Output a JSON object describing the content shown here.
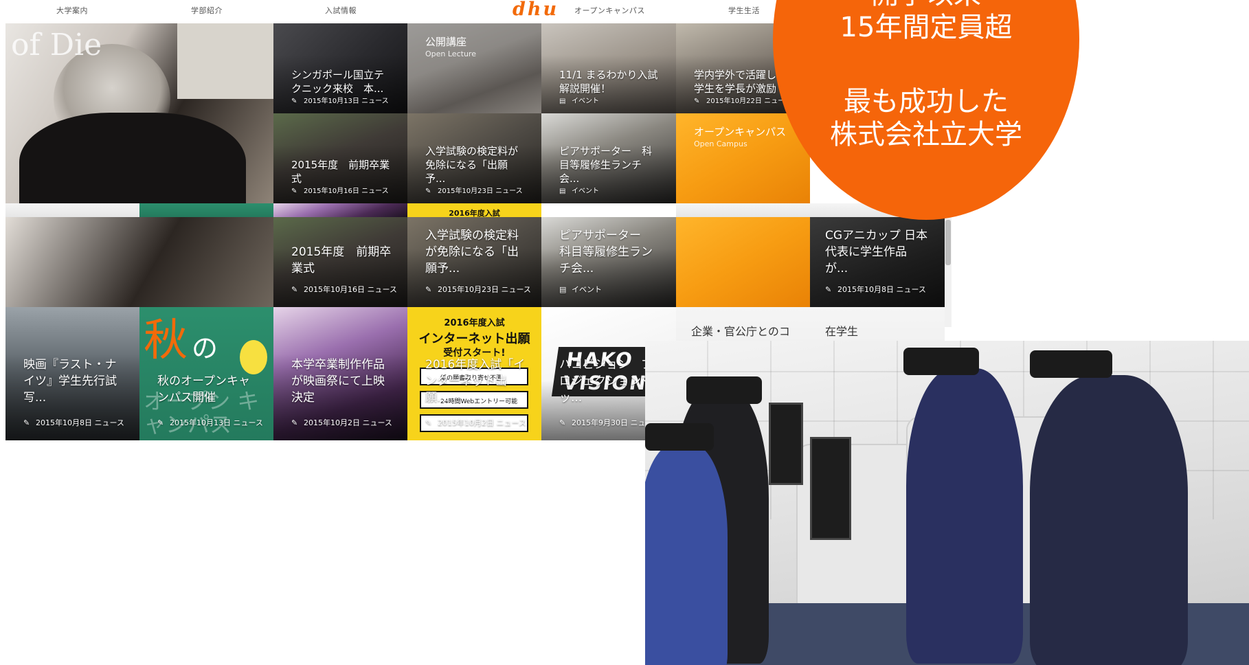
{
  "nav": {
    "items": [
      "大学案内",
      "学部紹介",
      "入試情報",
      "オープンキャンパス",
      "学生生活"
    ],
    "logo": "dhu"
  },
  "hero": {
    "overlay_text": "of Die"
  },
  "tiles": {
    "singapore": {
      "title": "シンガポール国立テクニック来校　本...",
      "meta": "2015年10月13日 ニュース",
      "icon": "pencil"
    },
    "lecture": {
      "label": "公開講座",
      "sublabel": "Open Lecture"
    },
    "nyushi": {
      "title": "11/1 まるわかり入試解説開催！",
      "meta": "イベント",
      "icon": "calendar"
    },
    "student_active": {
      "title": "学内学外で活躍した学生を学長が激励",
      "meta": "2015年10月22日 ニュース",
      "icon": "pencil"
    },
    "graduation": {
      "title": "2015年度　前期卒業式",
      "meta": "2015年10月16日 ニュース",
      "icon": "pencil"
    },
    "fee_waiver": {
      "title": "入学試験の検定料が免除になる「出願予...",
      "meta": "2015年10月23日 ニュース",
      "icon": "pencil"
    },
    "peer": {
      "title": "ピアサポーター　科目等履修生ランチ会...",
      "meta": "イベント",
      "icon": "calendar"
    },
    "opencampus": {
      "label": "オープンキャンパス",
      "sublabel": "Open Campus"
    },
    "row2_graduation": {
      "title": "2015年度　前期卒業式",
      "meta": "2015年10月16日 ニュース"
    },
    "row2_fee": {
      "title": "入学試験の検定料が免除になる「出願予...",
      "meta": "2015年10月23日 ニュース"
    },
    "row2_peer": {
      "title": "ピアサポーター　科目等履修生ランチ会...",
      "meta": "イベント"
    },
    "cg": {
      "title": "CGアニカップ 日本代表に学生作品が...",
      "meta": "2015年10月8日 ニュース"
    },
    "corporate": {
      "title": "企業・官公庁とのコ"
    },
    "current_student": {
      "title": "在学生"
    },
    "movie": {
      "title": "映画『ラスト・ナイツ』学生先行試写...",
      "meta": "2015年10月8日 ニュース"
    },
    "autumn_oc": {
      "title": "秋のオープンキャンパス開催",
      "meta": "2015年10月13日 ニュース",
      "big_char": "秋",
      "big_word": "の",
      "art_text": "オープン キャンパス"
    },
    "film_fest": {
      "title": "本学卒業制作作品が映画祭にて上映決定",
      "meta": "2015年10月2日 ニュース"
    },
    "internet_apply": {
      "title": "2016年度入試「インターネット出願...",
      "meta": "2015年10月2日 ニュース",
      "poster_head": "2016年度入試",
      "poster_main": "インターネット出願",
      "poster_sub": "受付スタート!",
      "poster_line1": "紙の願書取り寄せ不要",
      "poster_line2": "24時間Webエントリー可能"
    },
    "hako": {
      "title": "ハコビジョン　プロジェクションマッ...",
      "meta": "2015年9月30日 ニュース",
      "logo": "HAKO VISION"
    },
    "ghost_label": "2016年度入試"
  },
  "bubble": {
    "lines": [
      "開学以来",
      "15年間定員超",
      "",
      "最も成功した",
      "株式会社立大学"
    ]
  },
  "icons": {
    "pencil": "pencil-icon",
    "calendar": "calendar-icon"
  },
  "colors": {
    "brand_orange": "#f5650a",
    "logo_orange": "#f26a0a"
  }
}
